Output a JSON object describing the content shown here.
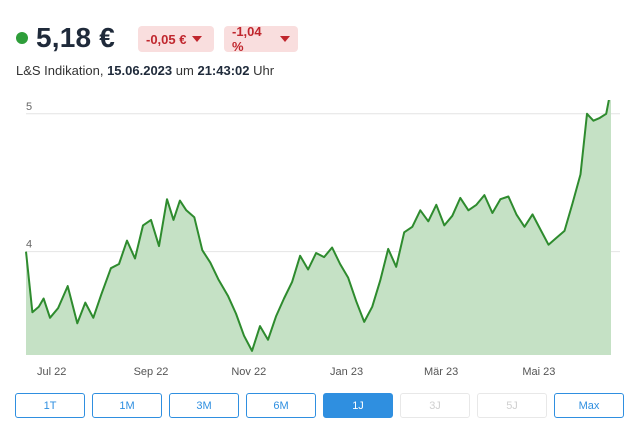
{
  "quote": {
    "price": "5,18 €",
    "change_abs": "-0,05 €",
    "change_pct": "-1,04 %",
    "source_label": "L&S Indikation,",
    "date": "15.06.2023",
    "time_prefix": "um",
    "time": "21:43:02",
    "time_suffix": "Uhr",
    "colors": {
      "up": "#2e9e3a",
      "down": "#c0262d",
      "down_bg": "#f9dede",
      "accent": "#2f8fe0"
    }
  },
  "chart_data": {
    "type": "area",
    "y_ticks": [
      "5",
      "4"
    ],
    "y_tick_values": [
      5,
      4
    ],
    "ylim": [
      3.25,
      5.1
    ],
    "x_tick_labels": [
      "Jul 22",
      "Sep 22",
      "Nov 22",
      "Jan 23",
      "Mär 23",
      "Mai 23"
    ],
    "x_tick_dates": [
      "2022-07-01",
      "2022-09-01",
      "2022-11-01",
      "2023-01-01",
      "2023-03-01",
      "2023-05-01"
    ],
    "xlim": [
      "2022-06-15",
      "2023-06-15"
    ],
    "grid": true,
    "line_color": "#2e8b2e",
    "fill_color": "#c5e1c5",
    "series": [
      {
        "points": [
          [
            "2022-06-15",
            4.0
          ],
          [
            "2022-06-19",
            3.56
          ],
          [
            "2022-06-23",
            3.6
          ],
          [
            "2022-06-26",
            3.66
          ],
          [
            "2022-06-30",
            3.52
          ],
          [
            "2022-07-05",
            3.59
          ],
          [
            "2022-07-11",
            3.75
          ],
          [
            "2022-07-17",
            3.48
          ],
          [
            "2022-07-22",
            3.63
          ],
          [
            "2022-07-27",
            3.52
          ],
          [
            "2022-08-01",
            3.69
          ],
          [
            "2022-08-07",
            3.88
          ],
          [
            "2022-08-12",
            3.91
          ],
          [
            "2022-08-17",
            4.08
          ],
          [
            "2022-08-22",
            3.95
          ],
          [
            "2022-08-27",
            4.19
          ],
          [
            "2022-09-01",
            4.23
          ],
          [
            "2022-09-06",
            4.04
          ],
          [
            "2022-09-11",
            4.38
          ],
          [
            "2022-09-15",
            4.23
          ],
          [
            "2022-09-19",
            4.37
          ],
          [
            "2022-09-23",
            4.3
          ],
          [
            "2022-09-28",
            4.25
          ],
          [
            "2022-10-03",
            4.01
          ],
          [
            "2022-10-08",
            3.92
          ],
          [
            "2022-10-13",
            3.8
          ],
          [
            "2022-10-19",
            3.68
          ],
          [
            "2022-10-24",
            3.55
          ],
          [
            "2022-10-29",
            3.39
          ],
          [
            "2022-11-03",
            3.28
          ],
          [
            "2022-11-08",
            3.46
          ],
          [
            "2022-11-13",
            3.36
          ],
          [
            "2022-11-18",
            3.53
          ],
          [
            "2022-11-23",
            3.66
          ],
          [
            "2022-11-28",
            3.78
          ],
          [
            "2022-12-03",
            3.97
          ],
          [
            "2022-12-08",
            3.87
          ],
          [
            "2022-12-13",
            3.99
          ],
          [
            "2022-12-18",
            3.96
          ],
          [
            "2022-12-23",
            4.03
          ],
          [
            "2022-12-28",
            3.91
          ],
          [
            "2023-01-02",
            3.81
          ],
          [
            "2023-01-07",
            3.64
          ],
          [
            "2023-01-12",
            3.49
          ],
          [
            "2023-01-17",
            3.6
          ],
          [
            "2023-01-22",
            3.79
          ],
          [
            "2023-01-27",
            4.02
          ],
          [
            "2023-02-01",
            3.89
          ],
          [
            "2023-02-06",
            4.14
          ],
          [
            "2023-02-11",
            4.18
          ],
          [
            "2023-02-16",
            4.3
          ],
          [
            "2023-02-21",
            4.22
          ],
          [
            "2023-02-26",
            4.34
          ],
          [
            "2023-03-03",
            4.19
          ],
          [
            "2023-03-08",
            4.26
          ],
          [
            "2023-03-13",
            4.39
          ],
          [
            "2023-03-18",
            4.3
          ],
          [
            "2023-03-23",
            4.34
          ],
          [
            "2023-03-28",
            4.41
          ],
          [
            "2023-04-02",
            4.28
          ],
          [
            "2023-04-07",
            4.38
          ],
          [
            "2023-04-12",
            4.4
          ],
          [
            "2023-04-17",
            4.27
          ],
          [
            "2023-04-22",
            4.18
          ],
          [
            "2023-04-27",
            4.27
          ],
          [
            "2023-05-02",
            4.16
          ],
          [
            "2023-05-07",
            4.05
          ],
          [
            "2023-05-12",
            4.1
          ],
          [
            "2023-05-17",
            4.15
          ],
          [
            "2023-05-22",
            4.35
          ],
          [
            "2023-05-27",
            4.56
          ],
          [
            "2023-05-31",
            5.0
          ],
          [
            "2023-06-04",
            4.95
          ],
          [
            "2023-06-08",
            4.97
          ],
          [
            "2023-06-12",
            5.0
          ],
          [
            "2023-06-15",
            5.18
          ]
        ]
      }
    ]
  },
  "ranges": {
    "active": "1J",
    "disabled": [
      "3J",
      "5J"
    ],
    "buttons": [
      "1T",
      "1M",
      "3M",
      "6M",
      "1J",
      "3J",
      "5J",
      "Max"
    ]
  }
}
